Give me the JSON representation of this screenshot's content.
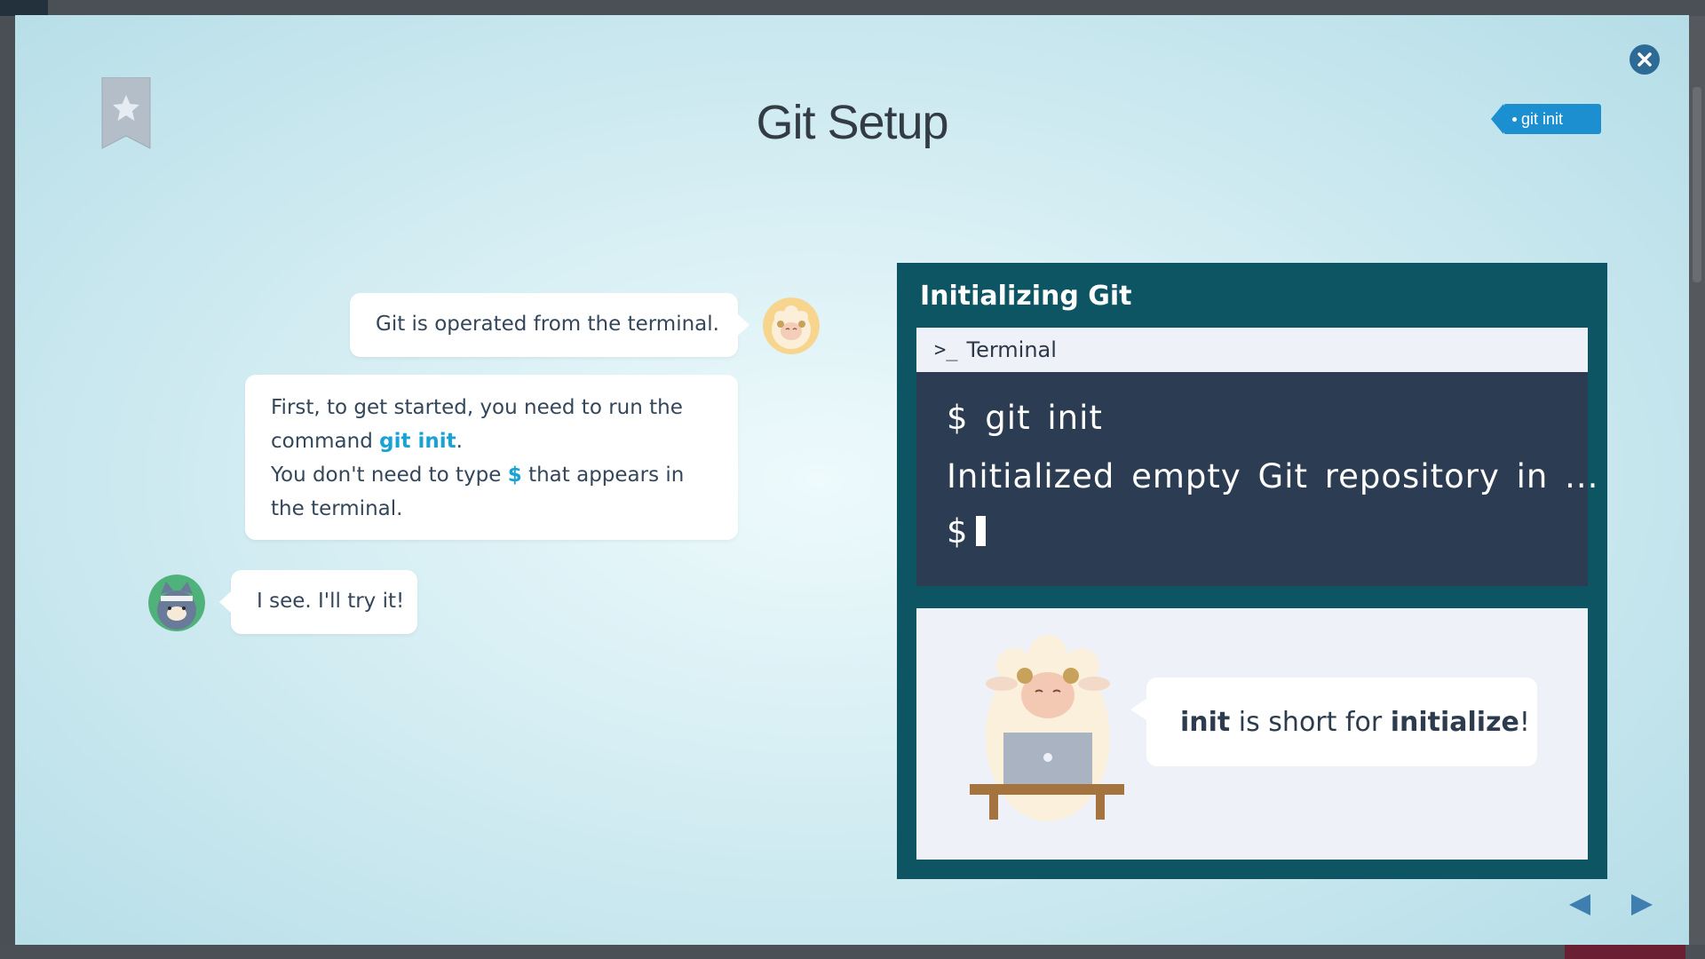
{
  "modal": {
    "title": "Git Setup",
    "tag_label": "git init"
  },
  "chat": {
    "msg1": "Git is operated from the terminal.",
    "msg2": {
      "part1": "First, to get started, you need to run the command ",
      "code": "git init",
      "part2": ".",
      "part3": "You don't need to type ",
      "dollar": "$",
      "part4": " that appears in the terminal."
    },
    "msg3": "I see. I'll try it!"
  },
  "panel": {
    "title": "Initializing Git",
    "terminal_label": "Terminal",
    "terminal_prompt_icon": ">_",
    "lines": [
      "$ git init",
      "Initialized empty Git repository in ...",
      "$"
    ],
    "tip": {
      "bold1": "init",
      "middle": " is short for ",
      "bold2": "initialize",
      "end": "!"
    }
  },
  "icons": [
    "bookmark-star-icon",
    "close-icon",
    "prev-arrow-icon",
    "next-arrow-icon",
    "sheep-avatar",
    "cat-avatar"
  ],
  "colors": {
    "panel_bg": "#0e5563",
    "terminal_bg": "#2c3c52",
    "accent": "#1ba2d4",
    "tag_bg": "#1b8fd0",
    "close_bg": "#2e6a96"
  }
}
